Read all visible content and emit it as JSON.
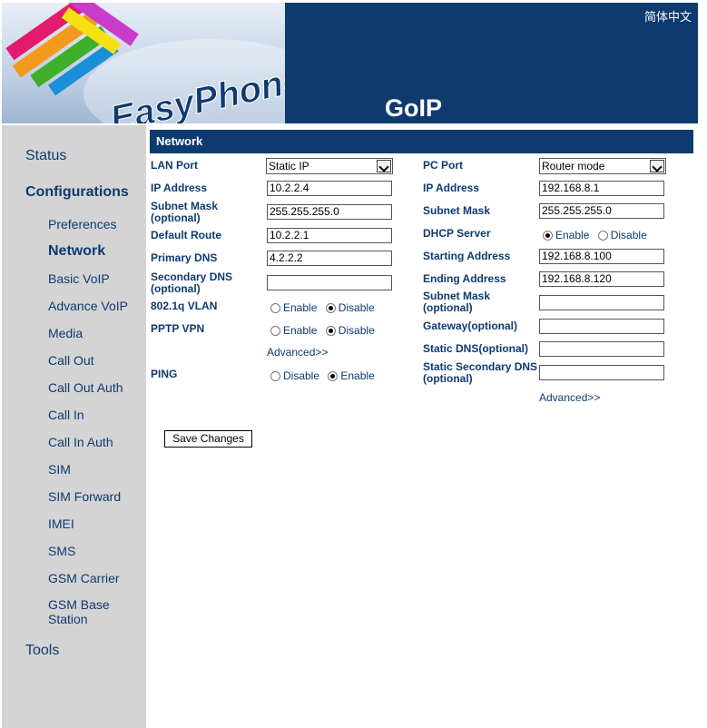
{
  "header": {
    "logo_text": "EasyPhone",
    "product_title": "GoIP",
    "language_link": "简体中文"
  },
  "sidebar": {
    "status": "Status",
    "configurations": "Configurations",
    "items": [
      {
        "label": "Preferences"
      },
      {
        "label": "Network"
      },
      {
        "label": "Basic VoIP"
      },
      {
        "label": "Advance VoIP"
      },
      {
        "label": "Media"
      },
      {
        "label": "Call Out"
      },
      {
        "label": "Call Out Auth"
      },
      {
        "label": "Call In"
      },
      {
        "label": "Call In Auth"
      },
      {
        "label": "SIM"
      },
      {
        "label": "SIM Forward"
      },
      {
        "label": "IMEI"
      },
      {
        "label": "SMS"
      },
      {
        "label": "GSM Carrier"
      },
      {
        "label": "GSM Base Station"
      }
    ],
    "tools": "Tools",
    "active": "Network"
  },
  "section_title": "Network",
  "lan": {
    "lan_port_label": "LAN Port",
    "lan_port_value": "Static IP",
    "ip_label": "IP Address",
    "ip_value": "10.2.2.4",
    "subnet_label_1": "Subnet Mask",
    "subnet_label_2": "(optional)",
    "subnet_value": "255.255.255.0",
    "route_label": "Default Route",
    "route_value": "10.2.2.1",
    "pdns_label": "Primary DNS",
    "pdns_value": "4.2.2.2",
    "sdns_label_1": "Secondary DNS",
    "sdns_label_2": "(optional)",
    "sdns_value": "",
    "vlan_label": "802.1q VLAN",
    "vlan_enable": "Enable",
    "vlan_disable": "Disable",
    "pptp_label": "PPTP VPN",
    "pptp_enable": "Enable",
    "pptp_disable": "Disable",
    "advanced": "Advanced>>",
    "ping_label": "PING",
    "ping_disable": "Disable",
    "ping_enable": "Enable"
  },
  "pc": {
    "pc_port_label": "PC Port",
    "pc_port_value": "Router mode",
    "ip_label": "IP Address",
    "ip_value": "192.168.8.1",
    "subnet_label": "Subnet Mask",
    "subnet_value": "255.255.255.0",
    "dhcp_label": "DHCP Server",
    "dhcp_enable": "Enable",
    "dhcp_disable": "Disable",
    "start_label": "Starting Address",
    "start_value": "192.168.8.100",
    "end_label": "Ending Address",
    "end_value": "192.168.8.120",
    "subnet2_label_1": "Subnet Mask",
    "subnet2_label_2": "(optional)",
    "subnet2_value": "",
    "gateway_label": "Gateway(optional)",
    "gateway_value": "",
    "sdns_label": "Static DNS(optional)",
    "sdns_value": "",
    "ssdns_label_1": "Static Secondary DNS",
    "ssdns_label_2": "(optional)",
    "ssdns_value": "",
    "advanced": "Advanced>>"
  },
  "save_button": "Save Changes",
  "colors": {
    "header_bg": "#0e3a70",
    "sidebar_bg": "#d4d4d4",
    "label_text": "#0e3a70"
  }
}
